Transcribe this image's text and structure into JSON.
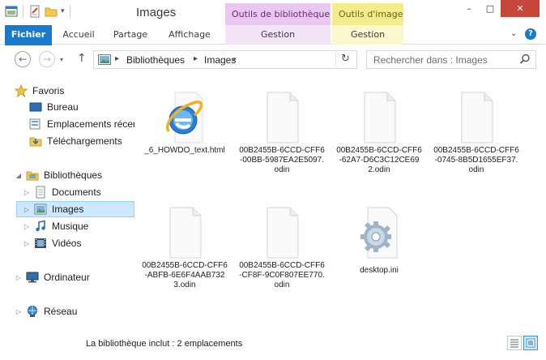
{
  "window": {
    "title": "Images",
    "context_library": "Outils de bibliothèque",
    "context_image": "Outils d'image",
    "close_glyph": "✕",
    "minimize_glyph": "–",
    "maximize_glyph": "□"
  },
  "ribbon": {
    "tabs": [
      {
        "label": "Fichier"
      },
      {
        "label": "Accueil"
      },
      {
        "label": "Partage"
      },
      {
        "label": "Affichage"
      },
      {
        "label": "Gestion"
      },
      {
        "label": "Gestion"
      }
    ],
    "help_glyph": "?"
  },
  "address": {
    "crumbs": [
      "Bibliothèques",
      "Images"
    ],
    "search_placeholder": "Rechercher dans : Images"
  },
  "nav": {
    "favorites": "Favoris",
    "desktop": "Bureau",
    "recent": "Emplacements récents",
    "downloads": "Téléchargements",
    "libraries": "Bibliothèques",
    "documents": "Documents",
    "images": "Images",
    "music": "Musique",
    "videos": "Vidéos",
    "computer": "Ordinateur",
    "network": "Réseau"
  },
  "files": [
    {
      "name": "_6_HOWDO_text.html",
      "icon": "ie-html"
    },
    {
      "name": "00B2455B-6CCD-CFF6-00BB-5987EA2E5097.odin",
      "icon": "blank"
    },
    {
      "name": "00B2455B-6CCD-CFF6-62A7-D6C3C12CE692.odin",
      "icon": "blank"
    },
    {
      "name": "00B2455B-6CCD-CFF6-0745-8B5D1655EF37.odin",
      "icon": "blank"
    },
    {
      "name": "00B2455B-6CCD-CFF6-ABFB-6E6F4AAB7323.odin",
      "icon": "blank"
    },
    {
      "name": "00B2455B-6CCD-CFF6-CF8F-9C0F807EE770.odin",
      "icon": "blank"
    },
    {
      "name": "desktop.ini",
      "icon": "settings-gear"
    }
  ],
  "status": {
    "text": "La bibliothèque inclut : 2 emplacements"
  }
}
